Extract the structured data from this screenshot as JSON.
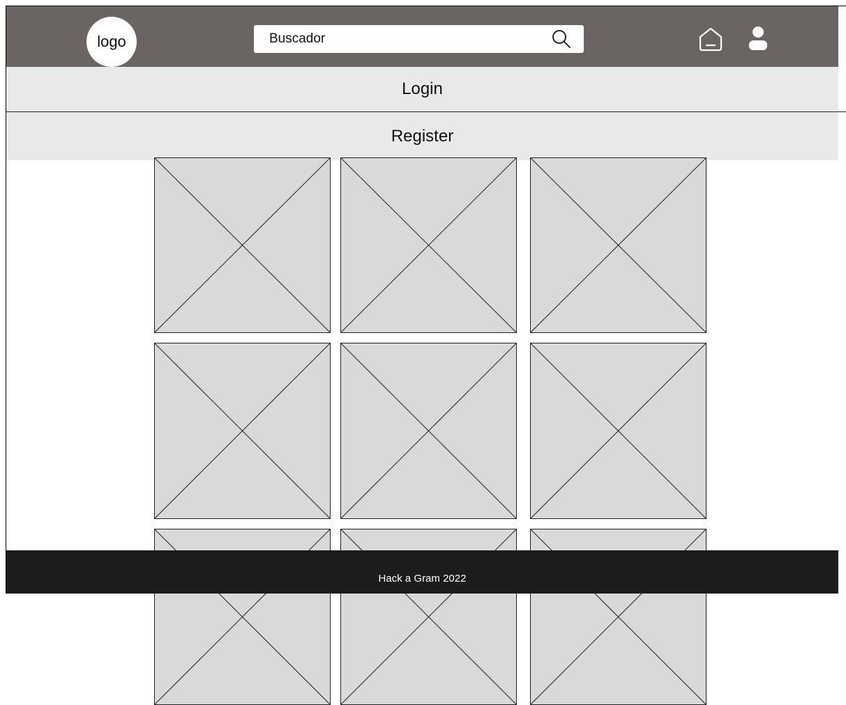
{
  "header": {
    "logo_text": "logo",
    "search": {
      "value": "Buscador"
    },
    "home_icon": "home-icon",
    "user_icon": "user-icon"
  },
  "menu": {
    "login_label": "Login",
    "register_label": "Register"
  },
  "gallery": {
    "tile_icon": "image-placeholder-icon"
  },
  "footer": {
    "text": "Hack a Gram 2022"
  },
  "colors": {
    "header_bg": "#6a6563",
    "menu_bg": "#e9e9e9",
    "tile_bg": "#d9d9d9",
    "footer_bg": "#1c1c1c"
  }
}
